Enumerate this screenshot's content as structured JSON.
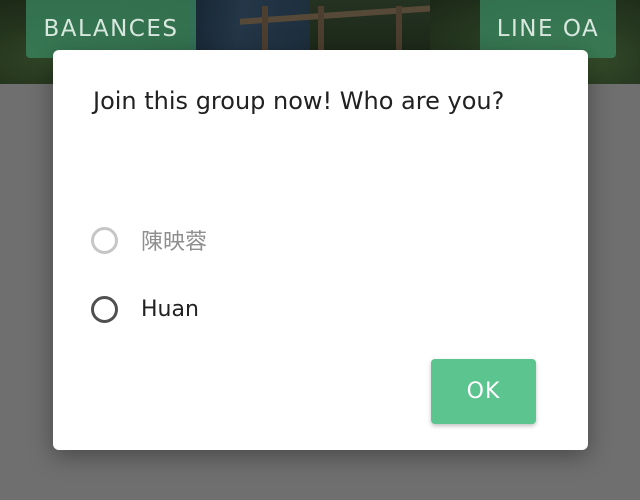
{
  "header": {
    "balances_label": "BALANCES",
    "line_oa_label": "LINE OA"
  },
  "dialog": {
    "title": "Join this group now! Who are you?",
    "options": [
      {
        "label": "陳映蓉",
        "selected": false,
        "disabled": true
      },
      {
        "label": "Huan",
        "selected": false,
        "disabled": false
      }
    ],
    "ok_label": "OK"
  },
  "colors": {
    "accent_green": "#5cc48f",
    "header_button_green": "#3c8c64",
    "scrim_gray": "#6f6f6f"
  }
}
